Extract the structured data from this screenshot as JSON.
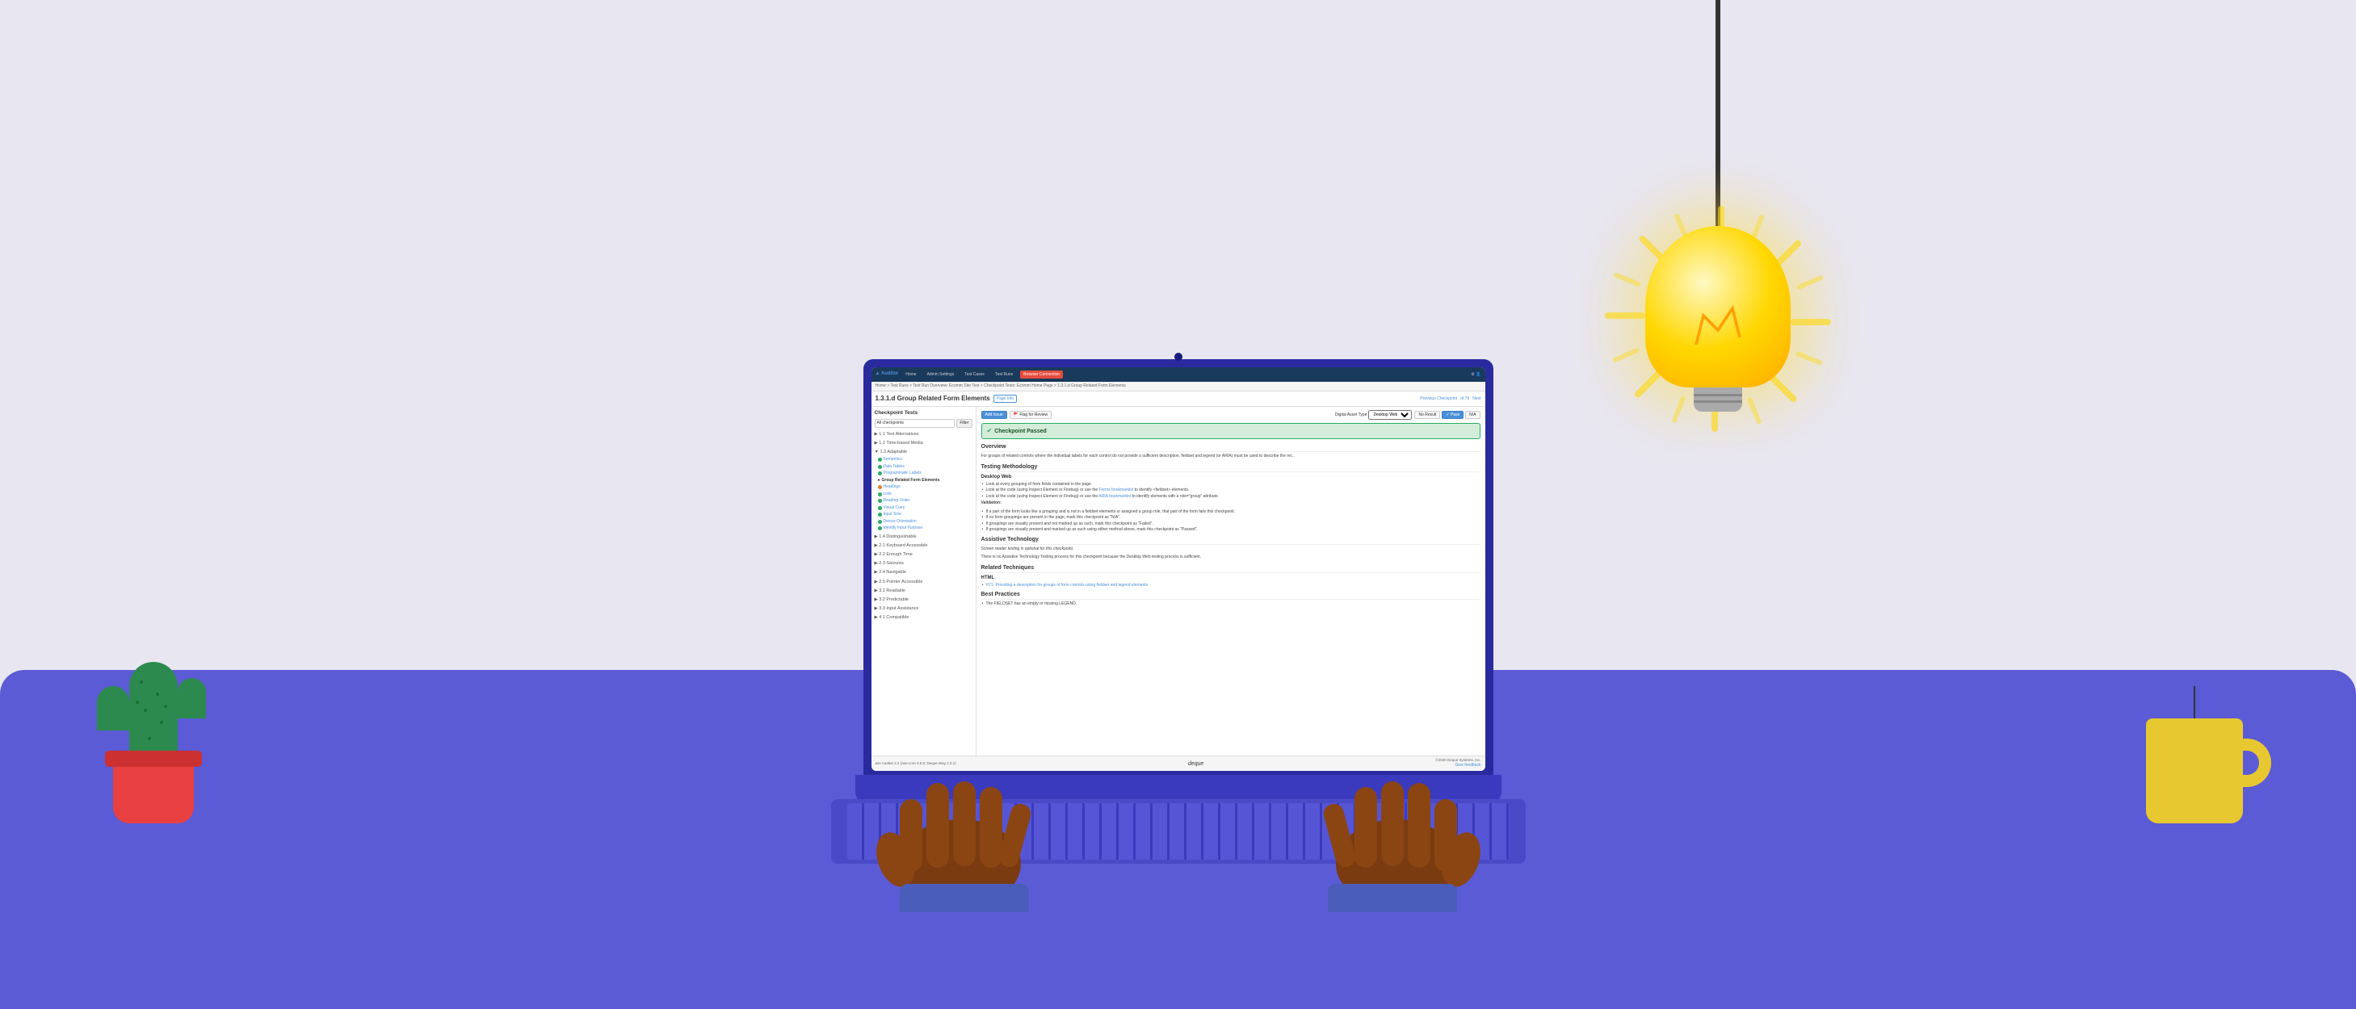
{
  "scene": {
    "background_color": "#e8e6f0",
    "desk_color": "#5b5bd6"
  },
  "nav": {
    "logo": "Auditor",
    "items": [
      "Home",
      "Admin Settings",
      "Test Cases",
      "Test Runs",
      "Browser Connection"
    ],
    "active_item": "Browser Connection",
    "icons": [
      "settings-icon",
      "user-icon"
    ]
  },
  "breadcrumb": {
    "text": "Home > Test Runs > Test Run Overview: Ecomm Site Test > Checkpoint Tests: Ecomm Home Page > 1.3.1.d Group Related Form Elements"
  },
  "page": {
    "title": "1.3.1.d Group Related Form Elements",
    "page_info": "Page Info",
    "nav_prev": "Previous Checkpoint",
    "nav_count": "of 79",
    "nav_next": "Next"
  },
  "sidebar": {
    "title": "Checkpoint Tests",
    "filter_placeholder": "All checkpoints",
    "filter_button": "Filter",
    "sections": [
      {
        "title": "1.1 Text Alternatives",
        "items": []
      },
      {
        "title": "1.2 Time-based Media",
        "items": []
      },
      {
        "title": "1.3 Adaptable",
        "items": [
          {
            "label": "Semantics",
            "status": "pass"
          },
          {
            "label": "Data Tables",
            "status": "pass"
          },
          {
            "label": "Programmatic Labels",
            "status": "pass"
          },
          {
            "label": "Group Related Form Elements",
            "status": "active"
          },
          {
            "label": "Headings",
            "status": "orange"
          },
          {
            "label": "Lists",
            "status": "pass"
          },
          {
            "label": "Reading Order",
            "status": "pass"
          },
          {
            "label": "Visual Cues",
            "status": "pass"
          },
          {
            "label": "Input Size",
            "status": "pass"
          },
          {
            "label": "Device Orientation",
            "status": "pass"
          },
          {
            "label": "Identify Input Purpose",
            "status": "pass"
          }
        ]
      },
      {
        "title": "1.4 Distinguishable",
        "items": []
      },
      {
        "title": "2.1 Keyboard Accessible",
        "items": []
      },
      {
        "title": "2.2 Enough Time",
        "items": []
      },
      {
        "title": "2.3 Seizures",
        "items": []
      },
      {
        "title": "2.4 Navigable",
        "items": []
      },
      {
        "title": "2.5 Pointer Accessible",
        "items": []
      },
      {
        "title": "3.1 Readable",
        "items": []
      },
      {
        "title": "3.2 Predictable",
        "items": []
      },
      {
        "title": "3.3 Input Assistance",
        "items": []
      },
      {
        "title": "4.1 Compatible",
        "items": []
      }
    ]
  },
  "toolbar": {
    "add_issue": "Add Issue",
    "flag_review": "Flag for Review",
    "digital_asset_type_label": "Digital Asset Type",
    "asset_type_value": "Desktop Web",
    "no_result": "No Result",
    "pass_btn": "Pass",
    "na_btn": "N/A"
  },
  "checkpoint": {
    "status": "Checkpoint Passed",
    "overview_title": "Overview",
    "overview_text": "For groups of related controls where the individual labels for each control do not provide a sufficient description, fieldset and legend (or ARIA) must be used to describe the rel...",
    "testing_methodology_title": "Testing Methodology",
    "desktop_web_title": "Desktop Web",
    "steps": [
      "Look at every grouping of form fields contained in the page.",
      "Look at the code (using Inspect Element or Firebug) or use the Forms bookmarklet to identify <fieldset> elements.",
      "Look at the code (using Inspect Element or Firebug) or use the ARIA bookmarklet to identify elements with a role=\"group\" attribute."
    ],
    "validation_title": "Validation:",
    "validation_items": [
      "If a part of the form looks like a grouping and is not in a fieldset elements or assigned a group role, that part of the form fails this checkpoint.",
      "If no form groupings are present in the page, mark this checkpoint as \"N/A\".",
      "If groupings are visually present and not marked up as such, mark this checkpoint as \"Failed\".",
      "If groupings are visually present and marked up as such using either method above, mark this checkpoint as \"Passed\"."
    ],
    "assistive_tech_title": "Assistive Technology",
    "screen_reader_note": "Screen reader testing is optional for this checkpoint.",
    "no_at_text": "There is no Assistive Technology Testing process for this checkpoint because the Desktop Web testing process is sufficient.",
    "related_techniques_title": "Related Techniques",
    "html_title": "HTML",
    "html_link": "H71: Providing a description for groups of form controls using fieldset and legend elements",
    "best_practices_title": "Best Practices",
    "best_practices_items": [
      "The FIELDSET has an empty or missing LEGEND."
    ]
  },
  "footer": {
    "version": "axe Auditor 2.2 (axe-core 3.5.5; Deque Way 2.3.1)",
    "copyright": "©2020 Deque Systems, Inc.",
    "feedback": "Give feedback",
    "logo": "deque"
  },
  "decorations": {
    "cactus_color": "#2d8a4e",
    "pot_color": "#e84040",
    "mug_color": "#e8c830",
    "bulb_color": "#ffd700"
  }
}
